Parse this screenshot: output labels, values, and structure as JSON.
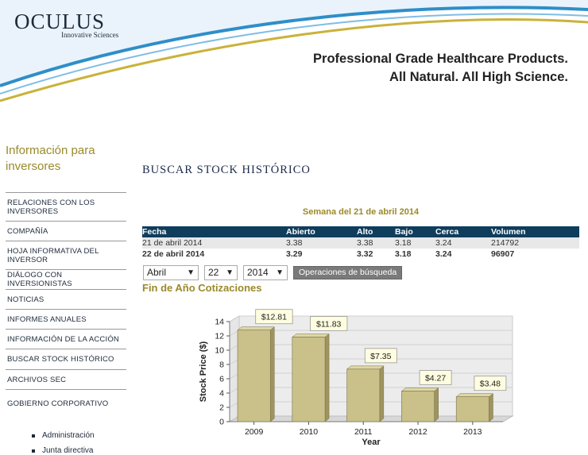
{
  "header": {
    "logo": "OCULUS",
    "logo_sub": "Innovative Sciences",
    "tagline_1": "Professional Grade Healthcare Products.",
    "tagline_2": "All Natural. All High Science.",
    "colors": {
      "swoosh_blue": "#2f8ec8",
      "swoosh_gold": "#c9b23a",
      "sky": "#eaf3fb"
    }
  },
  "sidebar": {
    "title": "Información para inversores",
    "items": [
      {
        "label": "RELACIONES CON LOS INVERSORES"
      },
      {
        "label": "COMPAÑÍA"
      },
      {
        "label": "HOJA INFORMATIVA DEL INVERSOR"
      },
      {
        "label": "DIÁLOGO CON INVERSIONISTAS"
      },
      {
        "label": "NOTICIAS"
      },
      {
        "label": "INFORMES ANUALES"
      },
      {
        "label": "INFORMACIÓN DE LA ACCIÓN"
      },
      {
        "label": "BUSCAR STOCK HISTÓRICO"
      },
      {
        "label": "ARCHIVOS SEC"
      },
      {
        "label": "GOBIERNO CORPORATIVO"
      }
    ],
    "subitems": [
      {
        "label": "Administración"
      },
      {
        "label": "Junta directiva"
      }
    ]
  },
  "main": {
    "title": "BUSCAR STOCK HISTÓRICO",
    "week_caption": "Semana del 21 de abril 2014",
    "table": {
      "headers": [
        "Fecha",
        "Abierto",
        "Alto",
        "Bajo",
        "Cerca",
        "Volumen"
      ],
      "rows": [
        [
          "21 de abril 2014",
          "3.38",
          "3.38",
          "3.18",
          "3.24",
          "214792"
        ],
        [
          "22 de abril 2014",
          "3.29",
          "3.32",
          "3.18",
          "3.24",
          "96907"
        ]
      ]
    },
    "controls": {
      "month": "Abril",
      "day": "22",
      "year": "2014",
      "search_label": "Operaciones de búsqueda"
    },
    "chart_heading": "Fin de Año Cotizaciones"
  },
  "chart_data": {
    "type": "bar",
    "categories": [
      "2009",
      "2010",
      "2011",
      "2012",
      "2013"
    ],
    "values": [
      12.81,
      11.83,
      7.35,
      4.27,
      3.48
    ],
    "data_labels": [
      "$12.81",
      "$11.83",
      "$7.35",
      "$4.27",
      "$3.48"
    ],
    "title": "",
    "xlabel": "Year",
    "ylabel": "Stock Price ($)",
    "ylim": [
      0,
      14
    ],
    "yticks": [
      "0",
      "2",
      "4",
      "6",
      "8",
      "10",
      "12",
      "14"
    ],
    "grid": true,
    "bar_color": "#c9c08a",
    "label_bg": "#fffde0"
  }
}
